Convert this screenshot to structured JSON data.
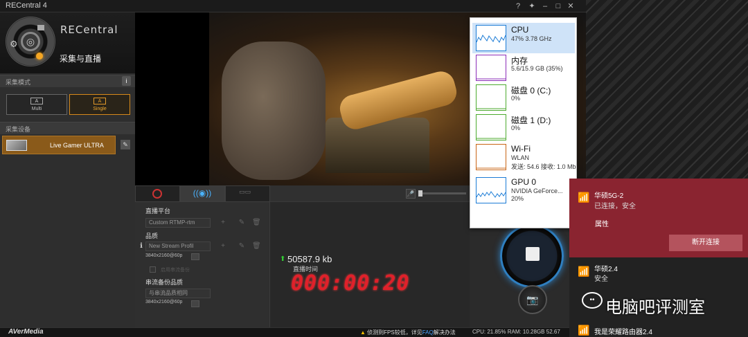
{
  "app": {
    "title": "RECentral 4",
    "brand": "RECentral",
    "mode_title": "采集与直播"
  },
  "titlebar_icons": [
    "help-icon",
    "pin-icon",
    "minimize-icon",
    "maximize-icon",
    "close-icon"
  ],
  "capture_mode": {
    "header": "采集模式",
    "options": [
      {
        "icon": "A",
        "label": "Multi"
      },
      {
        "icon": "A",
        "label": "Single",
        "selected": true
      }
    ]
  },
  "capture_device": {
    "header": "采集设备",
    "name": "Live Gamer ULTRA"
  },
  "logo": "AVerMedia",
  "stream_form": {
    "platform_label": "直播平台",
    "platform_value": "Custom RTMP-rtm",
    "quality_label": "品质",
    "quality_value": "New Stream Profil",
    "quality_res": "3840x2160@60p",
    "backup_checkbox": "启用串流备份",
    "backup_quality_label": "串流备份品质",
    "backup_quality_value": "与串流品质相同",
    "backup_res": "3840x2160@60p"
  },
  "stream_stats": {
    "data_sent": "50587.9 kb",
    "time_label": "直播时间",
    "timer": "000:00:20"
  },
  "status_bar": {
    "warning_prefix": "侦测到FPS较低，详见",
    "warning_link": "FAQ",
    "warning_suffix": "解决办法",
    "cpu": "CPU: 21.85%",
    "ram": "RAM: 10.28GB",
    "extra": "52.67"
  },
  "task_manager": [
    {
      "name": "CPU",
      "sub": "47% 3.78 GHz",
      "color": "#1a7bd6",
      "selected": true
    },
    {
      "name": "内存",
      "sub": "5.6/15.9 GB (35%)",
      "color": "#8b2bb8"
    },
    {
      "name": "磁盘 0 (C:)",
      "sub": "0%",
      "color": "#4caa2d"
    },
    {
      "name": "磁盘 1 (D:)",
      "sub": "0%",
      "color": "#4caa2d"
    },
    {
      "name": "Wi-Fi",
      "sub": "WLAN",
      "sub2": "发送: 54.6  接收: 1.0 Mb",
      "color": "#c86414"
    },
    {
      "name": "GPU 0",
      "sub": "NVIDIA GeForce...",
      "sub2": "20%",
      "color": "#1a7bd6"
    }
  ],
  "wifi": {
    "networks": [
      {
        "name": "华硕5G-2",
        "status": "已连接，安全"
      },
      {
        "name": "华硕2.4",
        "status": "安全"
      },
      {
        "name": "我是荣耀路由器2.4",
        "status": ""
      }
    ],
    "properties": "属性",
    "disconnect": "断开连接"
  },
  "watermark": "电脑吧评测室"
}
